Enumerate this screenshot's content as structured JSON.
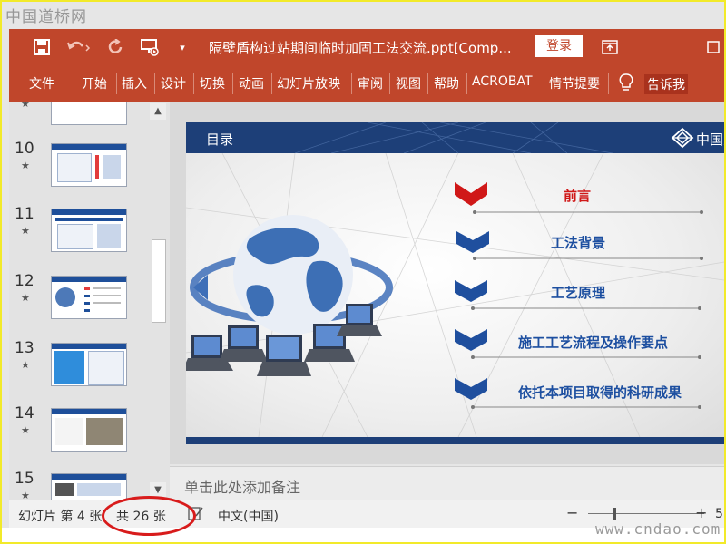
{
  "watermarks": {
    "top": "中国道桥网",
    "bottom": "www.cndao.com"
  },
  "titlebar": {
    "save_icon": "save-icon",
    "undo_icon": "undo-icon",
    "redo_icon": "redo-icon",
    "present_icon": "slideshow-from-start-icon",
    "customize_icon": "customize-quick-access-icon",
    "document_title": "隔壁盾构过站期间临时加固工法交流.ppt[Comp...",
    "login_label": "登录",
    "ribbon_display_icon": "ribbon-display-options-icon",
    "window_icon": "maximize-icon"
  },
  "ribbon": {
    "tabs": [
      "文件",
      "开始",
      "插入",
      "设计",
      "切换",
      "动画",
      "幻灯片放映",
      "审阅",
      "视图",
      "帮助",
      "ACROBAT",
      "情节提要"
    ],
    "tell_me_icon": "lightbulb-icon",
    "tell_me_label": "告诉我"
  },
  "thumbnails": [
    {
      "number": "10",
      "star": "★"
    },
    {
      "number": "11",
      "star": "★"
    },
    {
      "number": "12",
      "star": "★"
    },
    {
      "number": "13",
      "star": "★"
    },
    {
      "number": "14",
      "star": "★"
    },
    {
      "number": "15",
      "star": "★"
    }
  ],
  "slide": {
    "header_title": "目录",
    "logo_text": "中国交",
    "menu": [
      {
        "label": "前言",
        "active": true
      },
      {
        "label": "工法背景",
        "active": false
      },
      {
        "label": "工艺原理",
        "active": false
      },
      {
        "label": "施工工艺流程及操作要点",
        "active": false
      },
      {
        "label": "依托本项目取得的科研成果",
        "active": false
      }
    ],
    "colors": {
      "header": "#1d3f78",
      "active": "#d01818",
      "menu": "#1d4fa0"
    }
  },
  "notes": {
    "placeholder": "单击此处添加备注"
  },
  "status": {
    "slide_position": "幻灯片 第 4 张",
    "slide_total": "共 26 张",
    "notes_icon": "spellcheck-icon",
    "language": "中文(中国)",
    "zoom_minus": "−",
    "zoom_plus": "+",
    "zoom_value": "5"
  },
  "colors": {
    "app_accent": "#c0462b",
    "annotation": "#d81b1b"
  }
}
